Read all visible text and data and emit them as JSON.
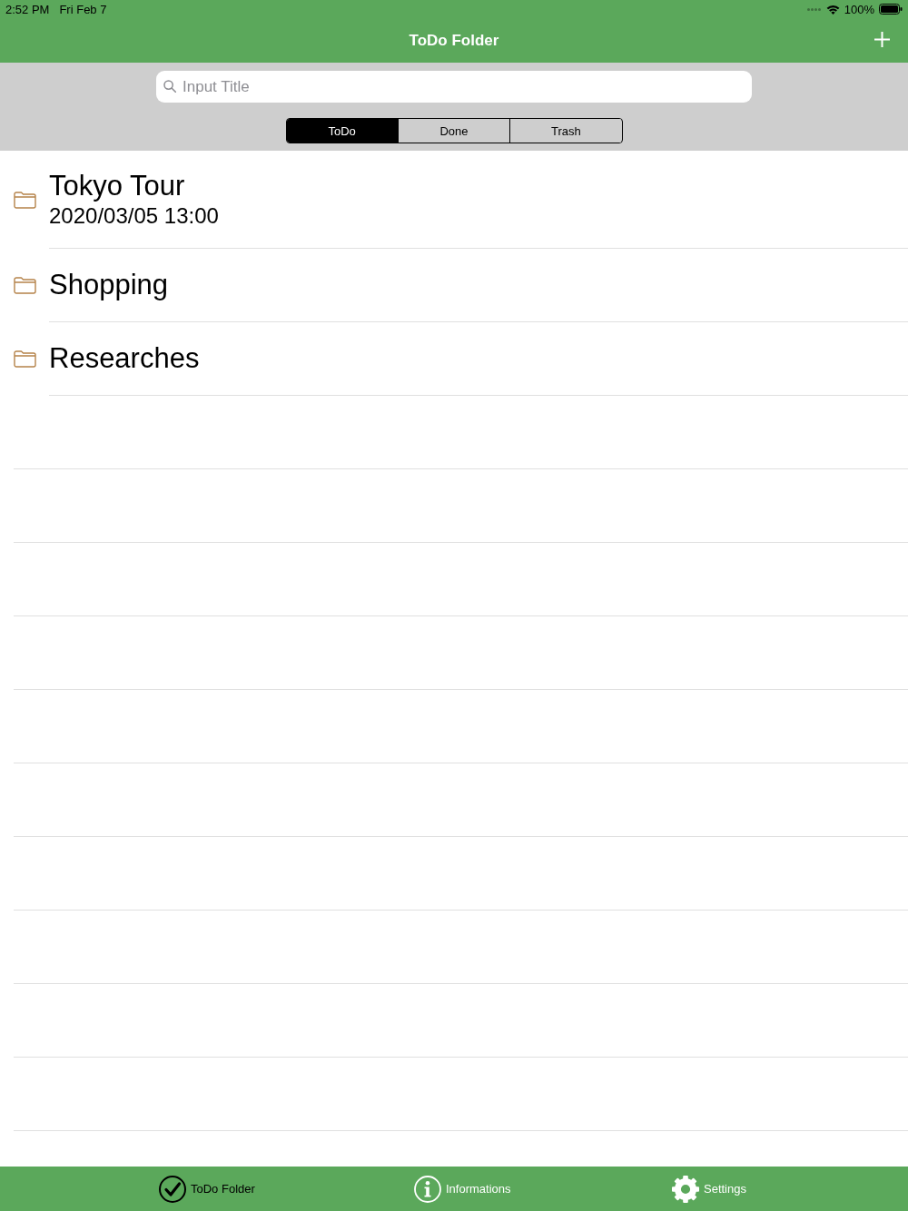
{
  "status_bar": {
    "time": "2:52 PM",
    "date": "Fri Feb 7",
    "battery": "100%"
  },
  "nav_bar": {
    "title": "ToDo Folder"
  },
  "search": {
    "placeholder": "Input Title"
  },
  "segments": [
    {
      "label": "ToDo",
      "selected": true
    },
    {
      "label": "Done",
      "selected": false
    },
    {
      "label": "Trash",
      "selected": false
    }
  ],
  "folders": [
    {
      "title": "Tokyo Tour",
      "date": "2020/03/05 13:00"
    },
    {
      "title": "Shopping"
    },
    {
      "title": "Researches"
    }
  ],
  "tab_bar": [
    {
      "label": "ToDo Folder",
      "kind": "check",
      "selected": true
    },
    {
      "label": "Informations",
      "kind": "info",
      "selected": false
    },
    {
      "label": "Settings",
      "kind": "gear",
      "selected": false
    }
  ]
}
